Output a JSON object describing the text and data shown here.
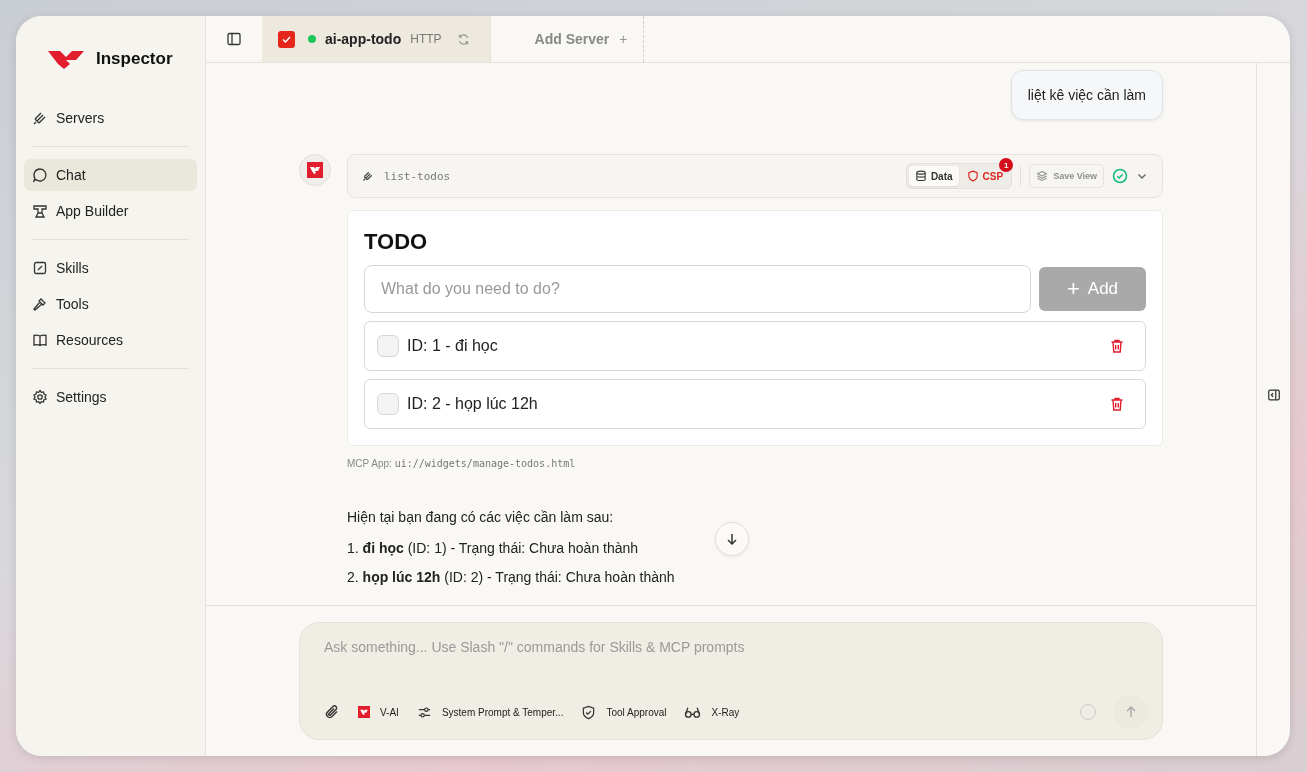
{
  "app": {
    "name": "Inspector"
  },
  "sidebar": {
    "groups": [
      {
        "items": [
          {
            "label": "Servers",
            "selected": false
          }
        ]
      },
      {
        "items": [
          {
            "label": "Chat",
            "selected": true
          },
          {
            "label": "App Builder",
            "selected": false
          }
        ]
      },
      {
        "items": [
          {
            "label": "Skills",
            "selected": false
          },
          {
            "label": "Tools",
            "selected": false
          },
          {
            "label": "Resources",
            "selected": false
          }
        ]
      },
      {
        "items": [
          {
            "label": "Settings",
            "selected": false
          }
        ]
      }
    ]
  },
  "tabs": [
    {
      "name": "ai-app-todo",
      "transport": "HTTP",
      "connected": true,
      "selected": true
    }
  ],
  "add_server": {
    "label": "Add Server",
    "icon": "+"
  },
  "chat": {
    "user_message": "liệt kê việc cần làm",
    "tool_call": {
      "name": "list-todos",
      "views": [
        {
          "label": "Data",
          "kind": "data",
          "selected": true
        },
        {
          "label": "CSP",
          "kind": "csp",
          "selected": false,
          "badge": "1"
        }
      ],
      "save_view": {
        "label": "Save View",
        "disabled": true
      },
      "succeeded": true,
      "expanded": false
    },
    "widget": {
      "title": "TODO",
      "input": {
        "placeholder": "What do you need to do?"
      },
      "add_button": {
        "icon": "+",
        "label": "Add",
        "disabled": true
      },
      "todos": [
        {
          "text": "ID: 1 - đi học",
          "checked": false
        },
        {
          "text": "ID: 2 - họp lúc 12h",
          "checked": false
        }
      ]
    },
    "app_source": {
      "label": "MCP App:",
      "uri": "ui://widgets/manage-todos.html"
    },
    "reply": {
      "intro": "Hiện tại bạn đang có các việc cần làm sau:",
      "items": [
        "1. **đi học** (ID: 1) - Trạng thái: Chưa hoàn thành",
        "2. **họp lúc 12h** (ID: 2) - Trạng thái: Chưa hoàn thành"
      ]
    }
  },
  "composer": {
    "placeholder": "Ask something... Use Slash \"/\" commands for Skills & MCP prompts",
    "tools": [
      {
        "label": "V-AI",
        "kind": "model"
      },
      {
        "label": "System Prompt & Temper...",
        "kind": "settings"
      },
      {
        "label": "Tool Approval",
        "kind": "approval"
      },
      {
        "label": "X-Ray",
        "kind": "xray"
      }
    ]
  }
}
